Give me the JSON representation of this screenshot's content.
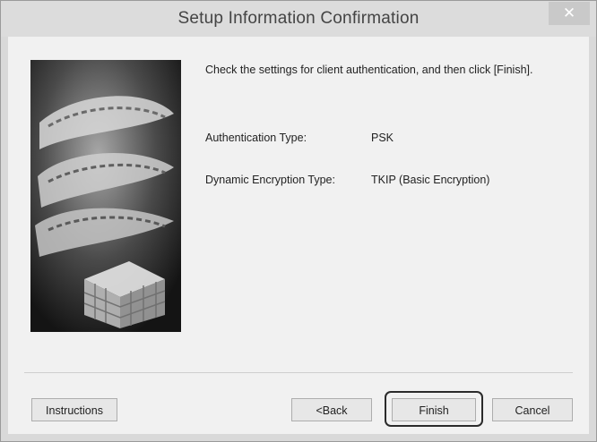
{
  "window": {
    "title": "Setup Information Confirmation",
    "close_glyph": "✕"
  },
  "main": {
    "message": "Check the settings for client authentication, and then click [Finish].",
    "fields": [
      {
        "label": "Authentication Type:",
        "value": "PSK"
      },
      {
        "label": "Dynamic Encryption Type:",
        "value": "TKIP (Basic Encryption)"
      }
    ]
  },
  "buttons": {
    "instructions": "Instructions",
    "back": "<Back",
    "finish": "Finish",
    "cancel": "Cancel"
  },
  "colors": {
    "focus_ring": "#2b2b2b",
    "window_bg": "#f1f1f1"
  }
}
